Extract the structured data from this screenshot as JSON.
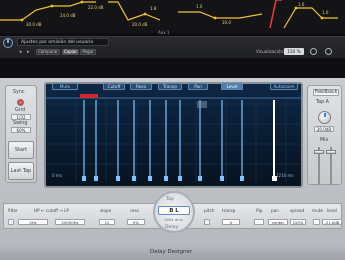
{
  "automation": {
    "values": [
      "30.0 dB",
      "24.0 dB",
      "22.0 dB",
      "20.0 dB",
      "1.8",
      "1.0",
      "16.0",
      "1.6",
      "1.0"
    ],
    "label": "Aux 1"
  },
  "header": {
    "preset": "Ajustes por omisión del usuario",
    "compare": "Comparar",
    "copy": "Copiar",
    "paste": "Pegar",
    "visualization_label": "Visualización:",
    "zoom": "150 %"
  },
  "left_panel": {
    "sync_label": "Sync",
    "grid_label": "Grid",
    "grid_value": "1/32",
    "swing_label": "Swing",
    "swing_value": "60%",
    "start_label": "Start",
    "last_tap_label": "Last Tap"
  },
  "display": {
    "tabs": [
      "Cutoff",
      "Reso",
      "Transp",
      "Pan",
      "Level"
    ],
    "active_tab": "Level",
    "mute_label": "Mute",
    "autozoom_label": "Autozoom",
    "left_time": "0 ms",
    "right_time": "1216 ms",
    "tap_letters": [
      "A",
      "B",
      "C",
      "D",
      "E",
      "F",
      "G",
      "H",
      "I",
      "J",
      "K",
      "L",
      "M"
    ]
  },
  "right_panel": {
    "feedback_label": "Feedback",
    "tap_value": "Tap A",
    "feedback_value": "20.0dB",
    "mix_label": "Mix",
    "dry_label": "Dry",
    "wet_label": "Wet"
  },
  "parameters": {
    "filter_label": "filter",
    "hp_label": "HP ← cutoff → LP",
    "filter_lo": "0Hz",
    "filter_hi": "20000Hz",
    "slope_label": "slope",
    "slope_value": "12",
    "reso_label": "reso",
    "reso_value": "0%",
    "pitch_label": "pitch",
    "transp_label": "transp",
    "pitch_value": "0",
    "flip_label": "flip",
    "pan_label": "pan",
    "spread_label": "spread",
    "pan_value": "center",
    "spread_value": "100%",
    "mute_label": "mute",
    "level_label": "level",
    "level_value": "-21.6dB"
  },
  "tap": {
    "title": "Tap",
    "selected": "B L",
    "time": "1694 dms",
    "delay_label": "Delay"
  },
  "footer": {
    "title": "Delay Designer"
  },
  "colors": {
    "accent_yellow": "#f2c230",
    "display_bg": "#0b1d33",
    "tap_line": "#7fc4ff",
    "led_red": "#d12a2a"
  }
}
